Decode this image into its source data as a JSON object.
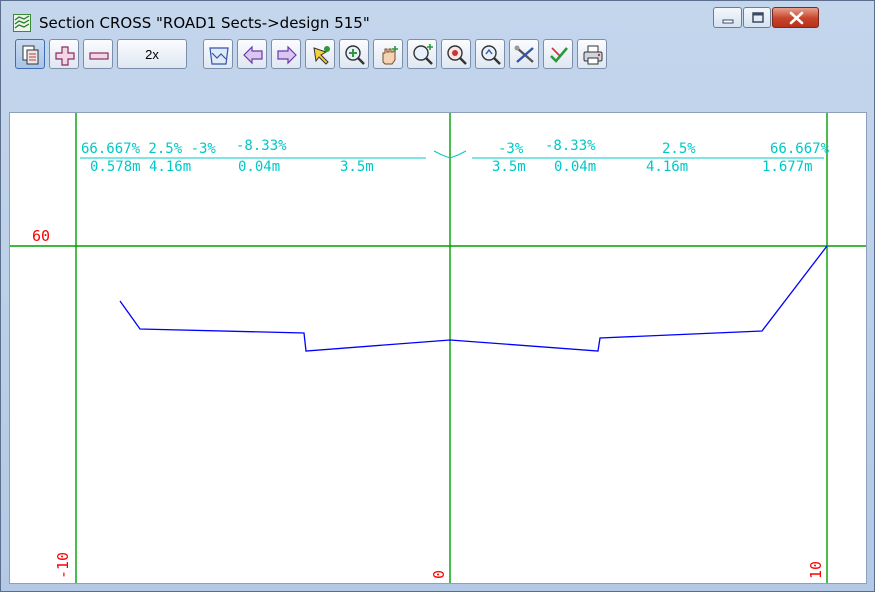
{
  "window": {
    "title": "Section CROSS \"ROAD1 Sects->design 515\"",
    "controls": [
      "minimize",
      "maximize",
      "close"
    ]
  },
  "toolbar": {
    "buttons": [
      {
        "name": "section-view-icon",
        "pressed": true
      },
      {
        "name": "zoom-in-plus-icon"
      },
      {
        "name": "zoom-out-minus-icon"
      },
      {
        "name": "scale-button",
        "label": "2x"
      },
      {
        "name": "section-shape-icon"
      },
      {
        "name": "previous-section-arrow-icon"
      },
      {
        "name": "next-section-arrow-icon"
      },
      {
        "name": "pick-tool-icon"
      },
      {
        "name": "zoom-window-icon"
      },
      {
        "name": "pan-hand-icon"
      },
      {
        "name": "zoom-add-icon"
      },
      {
        "name": "zoom-extents-icon"
      },
      {
        "name": "zoom-icon"
      },
      {
        "name": "tools-icon"
      },
      {
        "name": "settings-check-icon"
      },
      {
        "name": "print-icon"
      }
    ]
  },
  "section": {
    "grid": {
      "vlabels": [
        "-10",
        "0",
        "10"
      ],
      "hlabel": "60"
    },
    "annotations_left": {
      "grade_line": "66.667% 2.5% -3%",
      "overlap_left": "-8.33%",
      "width_line": "0.578m 4.16m",
      "overlap_left_w": "0.04m",
      "width_end": "3.5m"
    },
    "annotations_right": {
      "grade_start": "-3%",
      "overlap_right": "-8.33%",
      "grade_line": "2.5%",
      "grade_end": "66.667%",
      "width_start": "3.5m",
      "overlap_right_w": "0.04m",
      "width_line": "4.16m",
      "width_end": "1.677m"
    },
    "colors": {
      "grid": "#00a000",
      "labels": "#ff0000",
      "annotation": "#00c8c8",
      "profile": "#0000ff"
    }
  }
}
